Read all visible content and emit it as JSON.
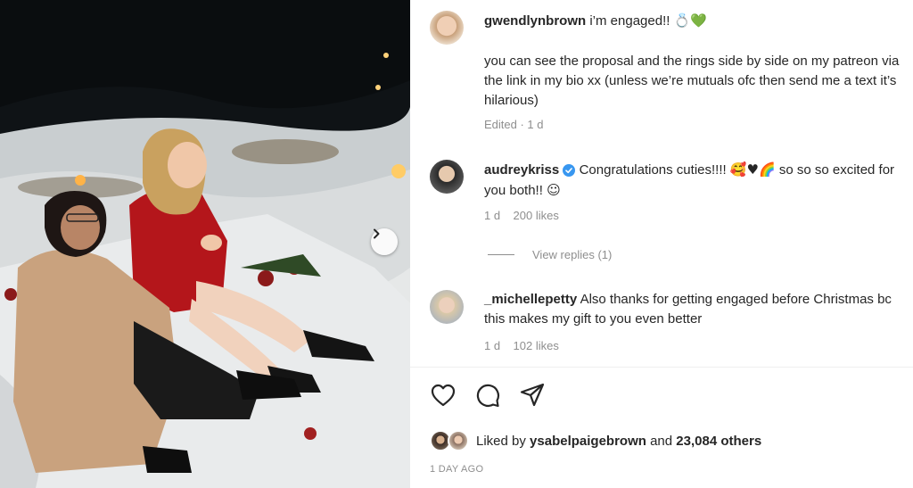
{
  "post": {
    "author": "gwendlynbrown",
    "headline": "i’m engaged!!",
    "headline_emoji": "💍💚",
    "body": "you can see the proposal and the rings side by side on my patreon via the link in my bio xx (unless we’re mutuals ofc then send me a text it’s hilarious)",
    "meta": "Edited · 1 d"
  },
  "comments": [
    {
      "username": "audreykriss",
      "verified": true,
      "text_a": "Congratulations cuties!!!!",
      "emojis": "🥰♥🌈",
      "text_b": "so so so excited for you both!!",
      "trailing_emoji": "☺",
      "time": "1 d",
      "likes": "200 likes",
      "view_replies": "View replies (1)"
    },
    {
      "username": "_michellepetty",
      "text": "Also thanks for getting engaged before Christmas bc this makes my gift to you even better",
      "time": "1 d",
      "likes": "102 likes"
    }
  ],
  "liked_by": {
    "prefix": "Liked by",
    "user": "ysabelpaigebrown",
    "connector": "and",
    "others": "23,084 others"
  },
  "time_ago": "1 DAY AGO",
  "icons": [
    "heart-icon",
    "comment-icon",
    "share-icon",
    "chevron-right-icon",
    "verified-badge-icon"
  ],
  "colors": {
    "verified": "#3897f0",
    "text": "#262626",
    "muted": "#8e8e8e"
  }
}
